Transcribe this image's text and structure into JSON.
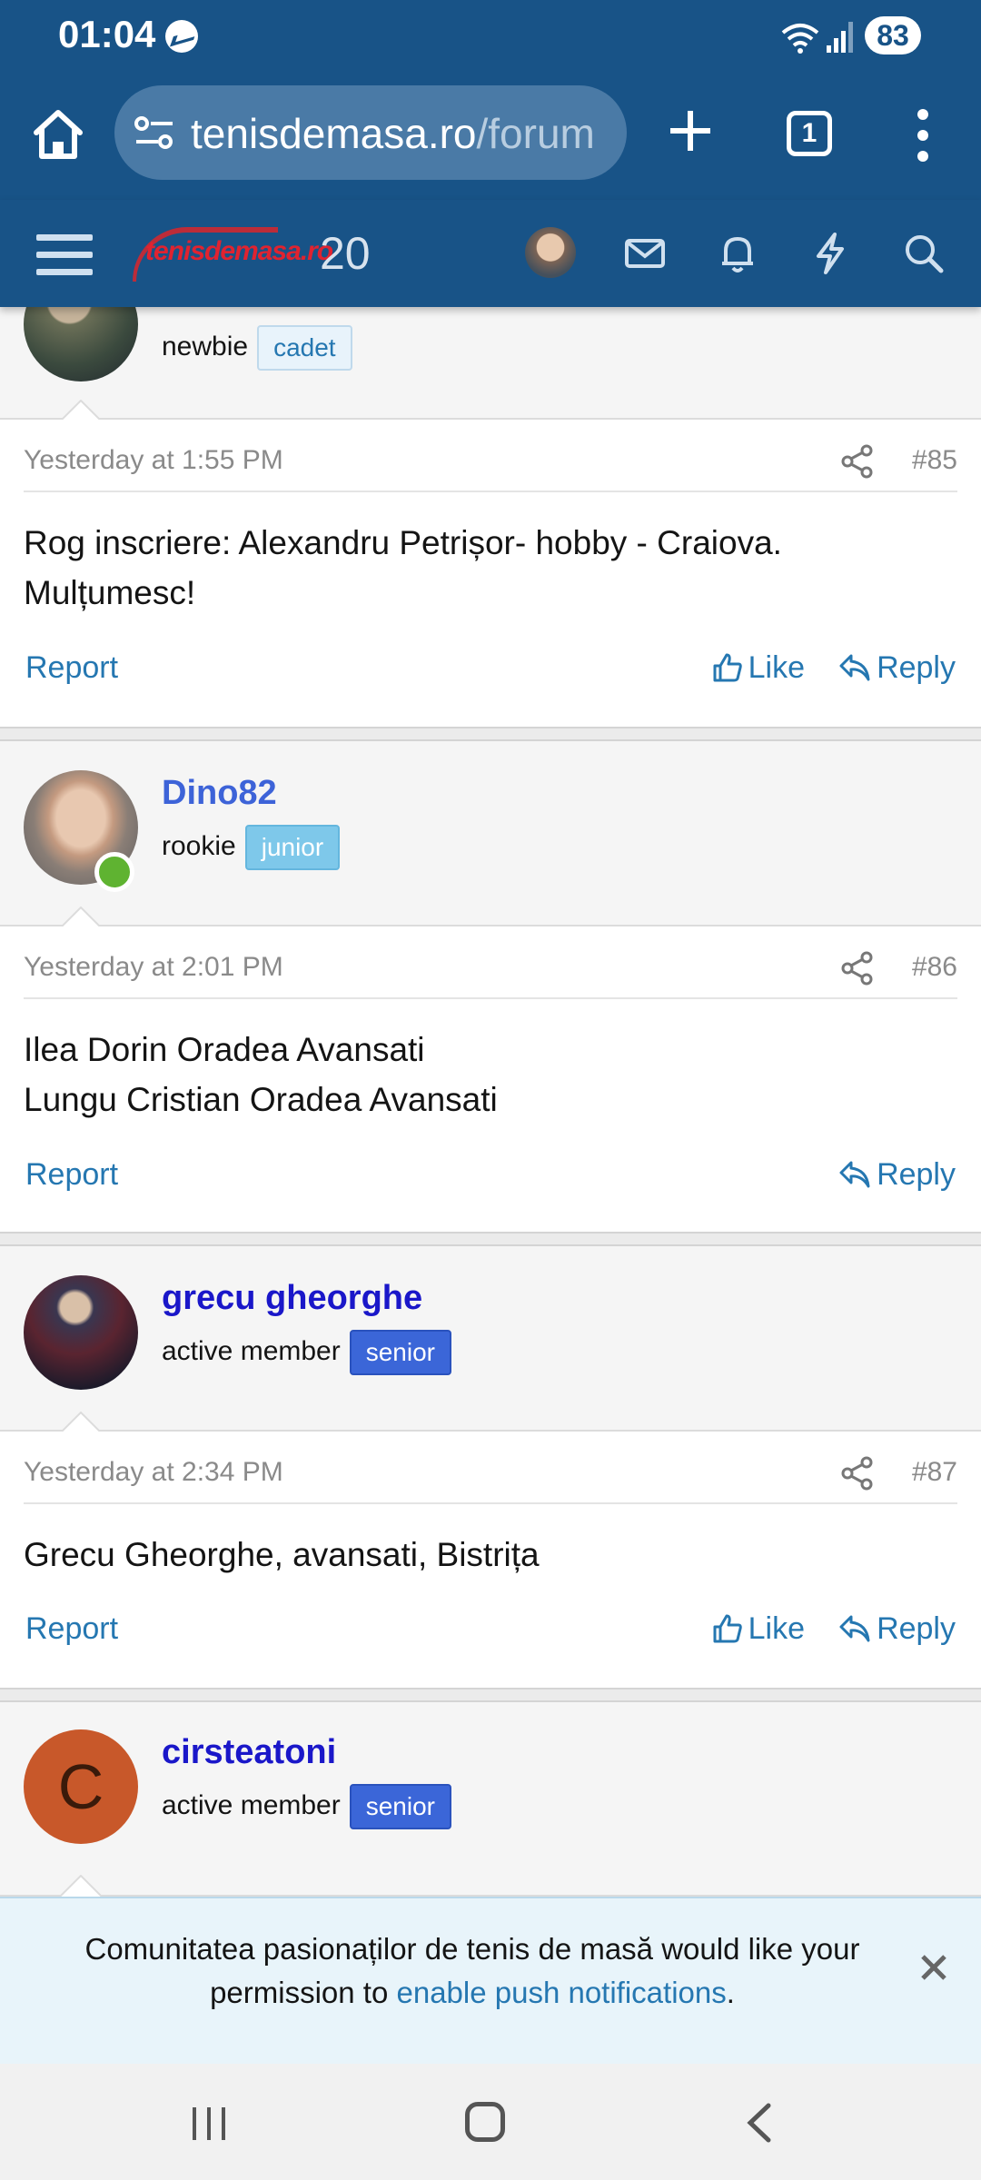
{
  "status_bar": {
    "time": "01:04",
    "battery": "83"
  },
  "browser": {
    "url_host": "tenisdemasa.ro",
    "url_path": "/forum",
    "tab_count": "1"
  },
  "site": {
    "logo_text": "tenisdemasa.ro",
    "logo_number": "20"
  },
  "posts": [
    {
      "username": "",
      "user_title": "newbie",
      "badge": "cadet",
      "date": "Yesterday at 1:55 PM",
      "number": "#85",
      "lines": [
        "Rog inscriere: Alexandru Petrișor- hobby - Craiova.",
        "Mulțumesc!"
      ],
      "report_label": "Report",
      "like_label": "Like",
      "reply_label": "Reply"
    },
    {
      "username": "Dino82",
      "user_title": "rookie",
      "badge": "junior",
      "date": "Yesterday at 2:01 PM",
      "number": "#86",
      "lines": [
        "Ilea Dorin Oradea Avansati",
        "Lungu Cristian Oradea Avansati"
      ],
      "report_label": "Report",
      "reply_label": "Reply"
    },
    {
      "username": "grecu gheorghe",
      "user_title": "active member",
      "badge": "senior",
      "date": "Yesterday at 2:34 PM",
      "number": "#87",
      "lines": [
        "Grecu Gheorghe, avansati, Bistrița"
      ],
      "report_label": "Report",
      "like_label": "Like",
      "reply_label": "Reply"
    },
    {
      "username": "cirsteatoni",
      "avatar_letter": "C",
      "user_title": "active member",
      "badge": "senior"
    }
  ],
  "push_notice": {
    "text_before": "Comunitatea pasionaților de tenis de masă would like your permission to ",
    "link": "enable push notifications",
    "text_after": "."
  },
  "colors": {
    "brand_blue": "#185387",
    "link_blue": "#2577b1",
    "username_dino": "#3d63d8",
    "username_dark": "#1a17c9",
    "online_green": "#5fb331",
    "avatar_orange": "#c8582a"
  }
}
